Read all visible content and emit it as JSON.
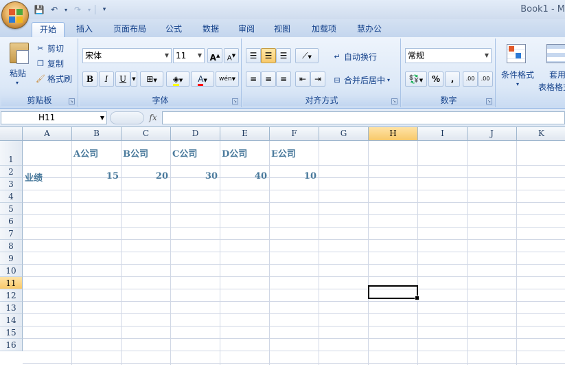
{
  "window": {
    "title": "Book1 - M"
  },
  "quick_access": {
    "save": "💾",
    "undo": "↶",
    "redo": "↷",
    "customize": "▾"
  },
  "tabs": [
    {
      "label": "开始",
      "active": true
    },
    {
      "label": "插入"
    },
    {
      "label": "页面布局"
    },
    {
      "label": "公式"
    },
    {
      "label": "数据"
    },
    {
      "label": "审阅"
    },
    {
      "label": "视图"
    },
    {
      "label": "加载项"
    },
    {
      "label": "慧办公"
    }
  ],
  "ribbon": {
    "clipboard": {
      "paste": "粘贴",
      "cut": "剪切",
      "copy": "复制",
      "format_painter": "格式刷",
      "label": "剪贴板"
    },
    "font": {
      "name": "宋体",
      "size": "11",
      "bold": "B",
      "italic": "I",
      "underline": "U",
      "grow": "A",
      "shrink": "A",
      "font_color": "A",
      "wen": "wén",
      "label": "字体"
    },
    "alignment": {
      "wrap": "自动换行",
      "merge": "合并后居中",
      "label": "对齐方式"
    },
    "number": {
      "format": "常规",
      "percent": "%",
      "comma": ",",
      "inc_decimal": ".00",
      "dec_decimal": ".00",
      "label": "数字"
    },
    "styles": {
      "conditional": "条件格式",
      "table_style_1": "套用",
      "table_style_2": "表格格式"
    }
  },
  "formula_bar": {
    "name_box": "H11",
    "fx": "fx",
    "content": ""
  },
  "sheet": {
    "columns": [
      "A",
      "B",
      "C",
      "D",
      "E",
      "F",
      "G",
      "H",
      "I",
      "J",
      "K"
    ],
    "rows": [
      "1",
      "2",
      "3",
      "4",
      "5",
      "6",
      "7",
      "8",
      "9",
      "10",
      "11",
      "12",
      "13",
      "14",
      "15",
      "16"
    ],
    "selected_column": "H",
    "selected_row": "11",
    "headers_row": [
      "A公司",
      "B公司",
      "C公司",
      "D公司",
      "E公司"
    ],
    "label_row2": "业绩",
    "values_row2": [
      "15",
      "20",
      "30",
      "40",
      "10"
    ]
  },
  "colors": {
    "accent": "#15428b",
    "cell_text": "#4a7a9c",
    "selection_header": "#f8c96a"
  }
}
